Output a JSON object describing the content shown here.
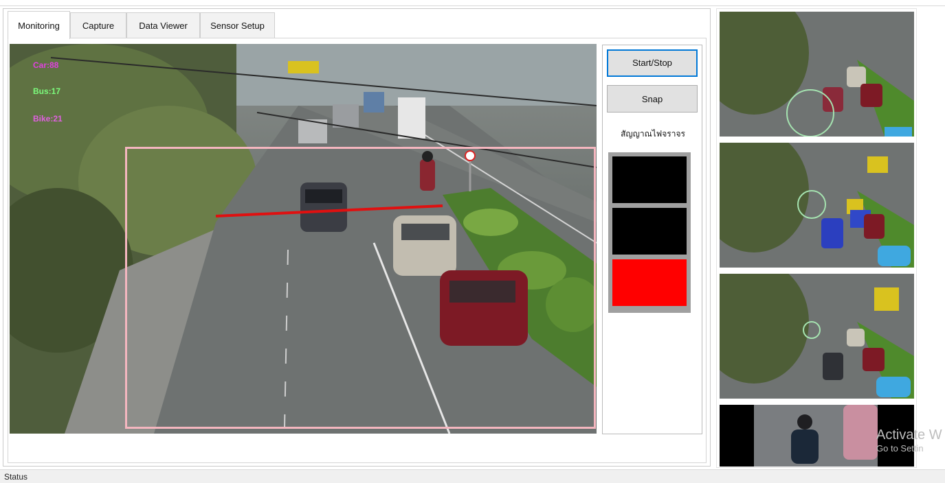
{
  "tabs": [
    {
      "label": "Monitoring",
      "active": true
    },
    {
      "label": "Capture",
      "active": false
    },
    {
      "label": "Data Viewer",
      "active": false
    },
    {
      "label": "Sensor Setup",
      "active": false
    }
  ],
  "camera": {
    "counters": [
      {
        "label": "Car:88",
        "color": "#e040e0"
      },
      {
        "label": "Bus:17",
        "color": "#7cfc7c"
      },
      {
        "label": "Bike:21",
        "color": "#e060e0"
      }
    ],
    "roi_color": "#f4b6bf",
    "line_color": "#e01010"
  },
  "controls": {
    "start_stop_label": "Start/Stop",
    "snap_label": "Snap",
    "signal_label": "สัญญาณไฟจราจร",
    "signal_states": [
      {
        "name": "top",
        "color": "#000000"
      },
      {
        "name": "middle",
        "color": "#000000"
      },
      {
        "name": "bottom",
        "color": "#ff0000"
      }
    ]
  },
  "watermark": {
    "line1": "Activate W",
    "line2": "Go to Settin"
  },
  "status": {
    "label": "Status"
  }
}
